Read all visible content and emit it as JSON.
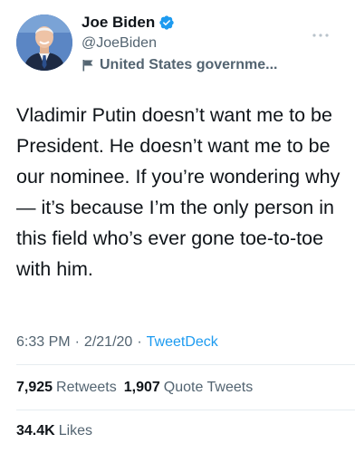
{
  "author": {
    "display_name": "Joe Biden",
    "handle": "@JoeBiden",
    "label": "United States governme...",
    "verified_icon": "verified-badge-icon",
    "label_icon": "flag-icon",
    "avatar": "avatar-photo"
  },
  "tweet": {
    "text": "Vladimir Putin doesn’t want me to be President. He doesn’t want me to be our nominee. If you’re wondering why — it’s because I’m the only person in this field who’s ever gone toe-to-toe with him.",
    "time": "6:33 PM",
    "date": "2/21/20",
    "separator": "·",
    "source": "TweetDeck"
  },
  "stats": {
    "retweets_count": "7,925",
    "retweets_label": "Retweets",
    "quotes_count": "1,907",
    "quotes_label": "Quote Tweets",
    "likes_count": "34.4K",
    "likes_label": "Likes"
  },
  "colors": {
    "text": "#0f1419",
    "secondary": "#536471",
    "accent": "#1d9bf0",
    "divider": "#e6ecf0"
  }
}
